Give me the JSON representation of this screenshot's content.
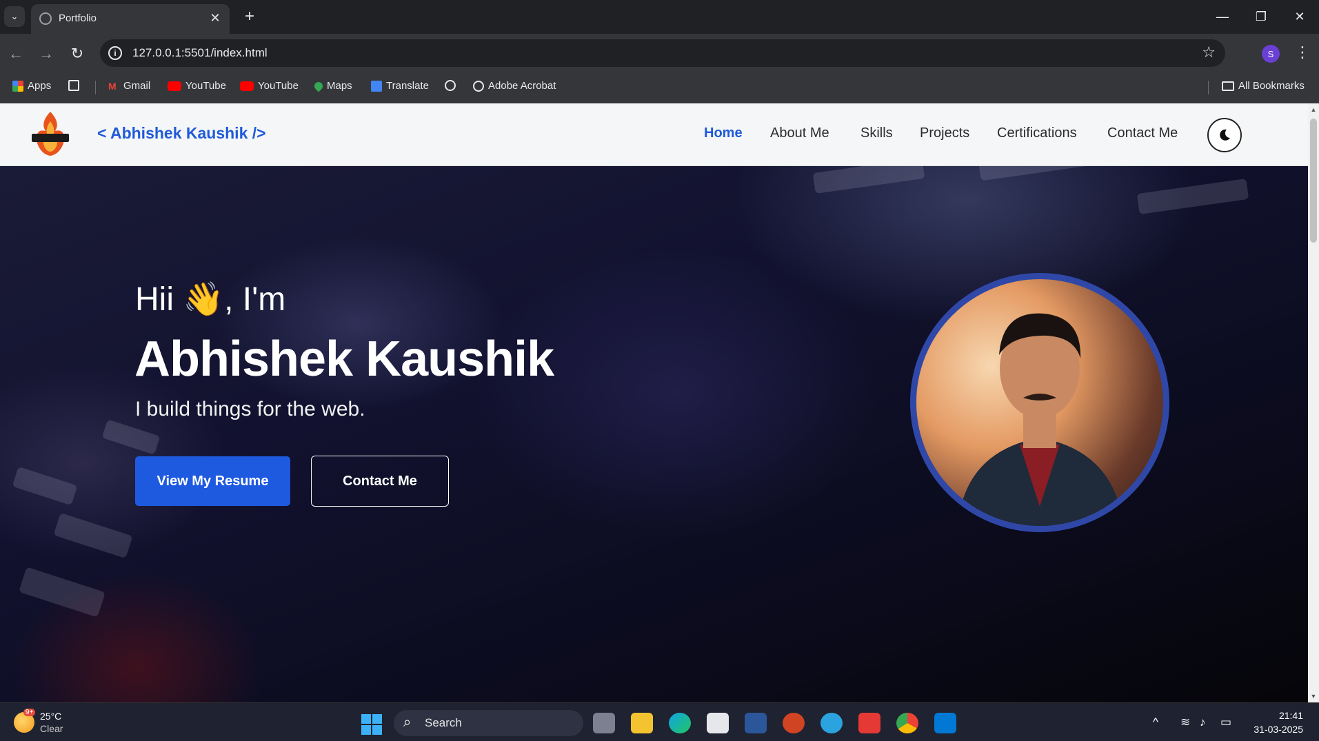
{
  "browser": {
    "tab_title": "Portfolio",
    "url": "127.0.0.1:5501/index.html",
    "bookmarks": [
      "Apps",
      "Gmail",
      "YouTube",
      "YouTube",
      "Maps",
      "Translate",
      "Adobe Acrobat"
    ],
    "all_bookmarks": "All Bookmarks",
    "profile_initial": "S"
  },
  "site": {
    "brand": "< Abhishek Kaushik />",
    "nav": [
      "Home",
      "About Me",
      "Skills",
      "Projects",
      "Certifications",
      "Contact Me"
    ],
    "active_nav": "Home",
    "accent_color": "#1f5ad8"
  },
  "hero": {
    "greeting_pre": "Hii",
    "greeting_emoji": "👋",
    "greeting_post": ", I'm",
    "name": "Abhishek Kaushik",
    "tagline": "I build things for the web.",
    "primary_button": "View My Resume",
    "secondary_button": "Contact Me"
  },
  "taskbar": {
    "temperature": "25°C",
    "condition": "Clear",
    "weather_badge": "9+",
    "search_label": "Search",
    "time": "21:41",
    "date": "31-03-2025"
  }
}
